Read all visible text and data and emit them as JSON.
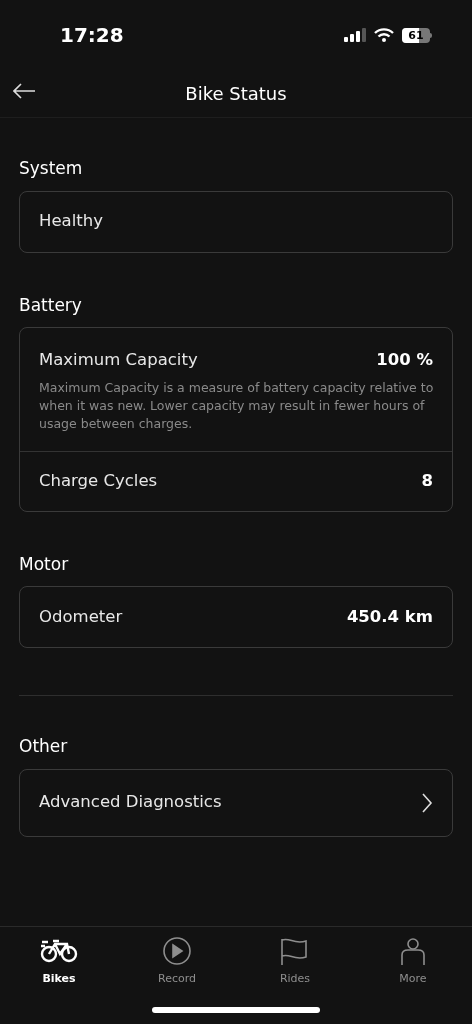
{
  "status_bar": {
    "time": "17:28",
    "battery": "61"
  },
  "header": {
    "title": "Bike Status"
  },
  "sections": [
    {
      "kind": "group",
      "title": "System",
      "rows": [
        {
          "kind": "text",
          "label": "Healthy"
        }
      ]
    },
    {
      "kind": "group",
      "title": "Battery",
      "rows": [
        {
          "kind": "value",
          "label": "Maximum Capacity",
          "value": "100 %",
          "description": "Maximum Capacity is a measure of battery capacity relative to when it was new. Lower capacity may result in fewer hours of usage between charges."
        },
        {
          "kind": "value",
          "label": "Charge Cycles",
          "value": "8"
        }
      ]
    },
    {
      "kind": "group",
      "title": "Motor",
      "rows": [
        {
          "kind": "value",
          "label": "Odometer",
          "value": "450.4 km"
        }
      ]
    },
    {
      "kind": "divider"
    },
    {
      "kind": "group",
      "title": "Other",
      "rows": [
        {
          "kind": "link",
          "label": "Advanced Diagnostics"
        }
      ]
    }
  ],
  "tab_bar": [
    {
      "label": "Bikes",
      "selected": true
    },
    {
      "label": "Record",
      "selected": false
    },
    {
      "label": "Rides",
      "selected": false
    },
    {
      "label": "More",
      "selected": false
    }
  ]
}
